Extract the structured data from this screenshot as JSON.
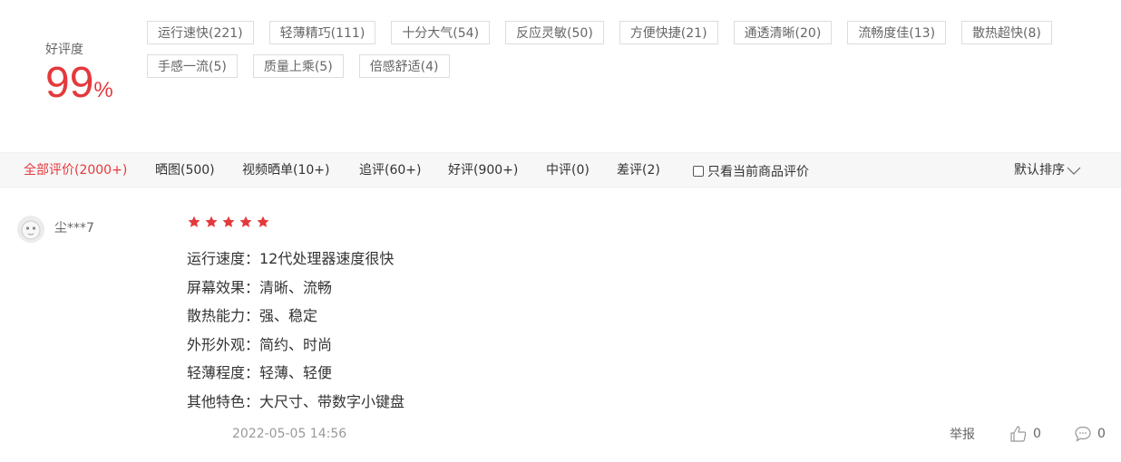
{
  "rating": {
    "label": "好评度",
    "value": "99",
    "unit": "%"
  },
  "tags": [
    "运行速快(221)",
    "轻薄精巧(111)",
    "十分大气(54)",
    "反应灵敏(50)",
    "方便快捷(21)",
    "通透清晰(20)",
    "流畅度佳(13)",
    "散热超快(8)",
    "手感一流(5)",
    "质量上乘(5)",
    "倍感舒适(4)"
  ],
  "filters": [
    {
      "label": "全部评价(2000+)",
      "active": true
    },
    {
      "label": "晒图(500)"
    },
    {
      "label": "视频晒单(10+)"
    },
    {
      "label": "追评(60+)"
    },
    {
      "label": "好评(900+)"
    },
    {
      "label": "中评(0)"
    },
    {
      "label": "差评(2)"
    }
  ],
  "only_current": {
    "label": "只看当前商品评价",
    "checked": false
  },
  "sort": {
    "label": "默认排序",
    "icon": "chevron-down-icon"
  },
  "review": {
    "user": "尘***7",
    "stars": 5,
    "star_color": "#e4393c",
    "lines": [
      "运行速度：12代处理器速度很快",
      "屏幕效果：清晰、流畅",
      "散热能力：强、稳定",
      "外形外观：简约、时尚",
      "轻薄程度：轻薄、轻便",
      "其他特色：大尺寸、带数字小键盘"
    ],
    "date": "2022-05-05 14:56",
    "report": "举报",
    "likes": "0",
    "comments": "0"
  }
}
